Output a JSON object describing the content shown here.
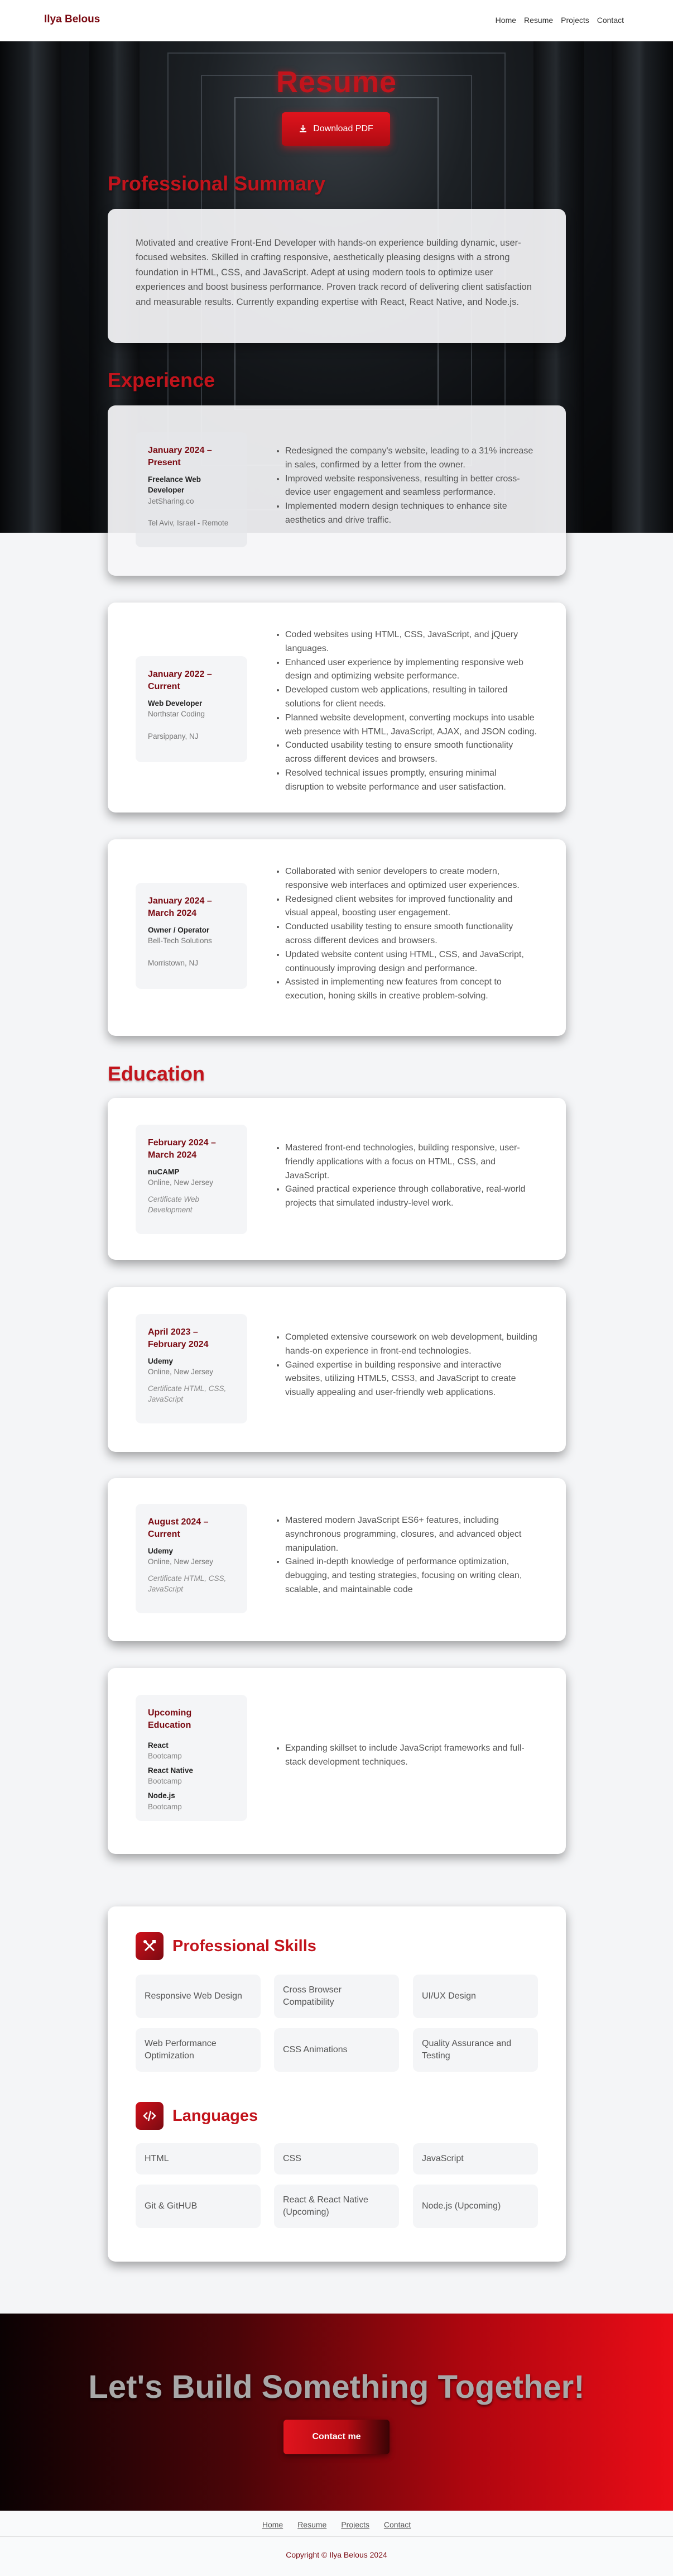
{
  "nav": {
    "brand": "Ilya Belous",
    "links": [
      "Home",
      "Resume",
      "Projects",
      "Contact"
    ]
  },
  "hero": {
    "title": "Resume",
    "download_label": "Download PDF"
  },
  "summary": {
    "title": "Professional Summary",
    "text": "Motivated and creative Front-End Developer with hands-on experience building dynamic, user-focused websites. Skilled in crafting responsive, aesthetically pleasing designs with a strong foundation in HTML, CSS, and JavaScript. Adept at using modern tools to optimize user experiences and boost business performance. Proven track record of delivering client satisfaction and measurable results. Currently expanding expertise with React, React Native, and Node.js."
  },
  "experience": {
    "title": "Experience",
    "items": [
      {
        "date": "January 2024 – Present",
        "role": "Freelance Web Developer",
        "org": "JetSharing.co",
        "location": "Tel Aviv, Israel - Remote",
        "bullets": [
          "Redesigned the company's website, leading to a 31% increase in sales, confirmed by a letter from the owner.",
          "Improved website responsiveness, resulting in better cross-device user engagement and seamless performance.",
          "Implemented modern design techniques to enhance site aesthetics and drive traffic."
        ]
      },
      {
        "date": "January 2022 – Current",
        "role": "Web Developer",
        "org": "Northstar Coding",
        "location": "Parsippany, NJ",
        "bullets": [
          "Coded websites using HTML, CSS, JavaScript, and jQuery languages.",
          "Enhanced user experience by implementing responsive web design and optimizing website performance.",
          "Developed custom web applications, resulting in tailored solutions for client needs.",
          "Planned website development, converting mockups into usable web presence with HTML, JavaScript, AJAX, and JSON coding.",
          "Conducted usability testing to ensure smooth functionality across different devices and browsers.",
          "Resolved technical issues promptly, ensuring minimal disruption to website performance and user satisfaction."
        ]
      },
      {
        "date": "January 2024 – March 2024",
        "role": "Owner / Operator",
        "org": "Bell-Tech Solutions",
        "location": "Morristown, NJ",
        "bullets": [
          "Collaborated with senior developers to create modern, responsive web interfaces and optimized user experiences.",
          "Redesigned client websites for improved functionality and visual appeal, boosting user engagement.",
          "Conducted usability testing to ensure smooth functionality across different devices and browsers.",
          "Updated website content using HTML, CSS, and JavaScript, continuously improving design and performance.",
          "Assisted in implementing new features from concept to execution, honing skills in creative problem-solving."
        ]
      }
    ]
  },
  "education": {
    "title": "Education",
    "items": [
      {
        "date": "February 2024 – March 2024",
        "school": "nuCAMP",
        "location": "Online, New Jersey",
        "cert": "Certificate Web Development",
        "bullets": [
          "Mastered front-end technologies, building responsive, user-friendly applications with a focus on HTML, CSS, and JavaScript.",
          "Gained practical experience through collaborative, real-world projects that simulated industry-level work."
        ]
      },
      {
        "date": "April 2023 – February 2024",
        "school": "Udemy",
        "location": "Online, New Jersey",
        "cert": "Certificate HTML, CSS, JavaScript",
        "bullets": [
          "Completed extensive coursework on web development, building hands-on experience in front-end technologies.",
          "Gained expertise in building responsive and interactive websites, utilizing HTML5, CSS3, and JavaScript to create visually appealing and user-friendly web applications."
        ]
      },
      {
        "date": "August 2024 – Current",
        "school": "Udemy",
        "location": "Online, New Jersey",
        "cert": "Certificate HTML, CSS, JavaScript",
        "bullets": [
          "Mastered modern JavaScript ES6+ features, including asynchronous programming, closures, and advanced object manipulation.",
          "Gained in-depth knowledge of performance optimization, debugging, and testing strategies, focusing on writing clean, scalable, and maintainable code"
        ]
      },
      {
        "date": "Upcoming Education",
        "upcoming": [
          {
            "name": "React",
            "type": "Bootcamp"
          },
          {
            "name": "React Native",
            "type": "Bootcamp"
          },
          {
            "name": "Node.js",
            "type": "Bootcamp"
          }
        ],
        "bullets": [
          "Expanding skillset to include JavaScript frameworks and full-stack development techniques."
        ]
      }
    ]
  },
  "skills": {
    "title": "Professional Skills",
    "icon": "tools-icon",
    "items": [
      "Responsive Web Design",
      "Cross Browser Compatibility",
      "UI/UX Design",
      "Web Performance Optimization",
      "CSS Animations",
      "Quality Assurance and Testing"
    ]
  },
  "languages": {
    "title": "Languages",
    "icon": "code-icon",
    "items": [
      "HTML",
      "CSS",
      "JavaScript",
      "Git & GitHUB",
      "React & React Native (Upcoming)",
      "Node.js (Upcoming)"
    ]
  },
  "cta": {
    "title": "Let's Build Something Together!",
    "button": "Contact me"
  },
  "footer": {
    "links": [
      "Home",
      "Resume",
      "Projects",
      "Contact"
    ],
    "copyright": "Copyright © Ilya Belous 2024"
  },
  "colors": {
    "accent": "#c2141c",
    "dark_accent": "#7a0a12",
    "page_bg": "#f4f5f7"
  }
}
